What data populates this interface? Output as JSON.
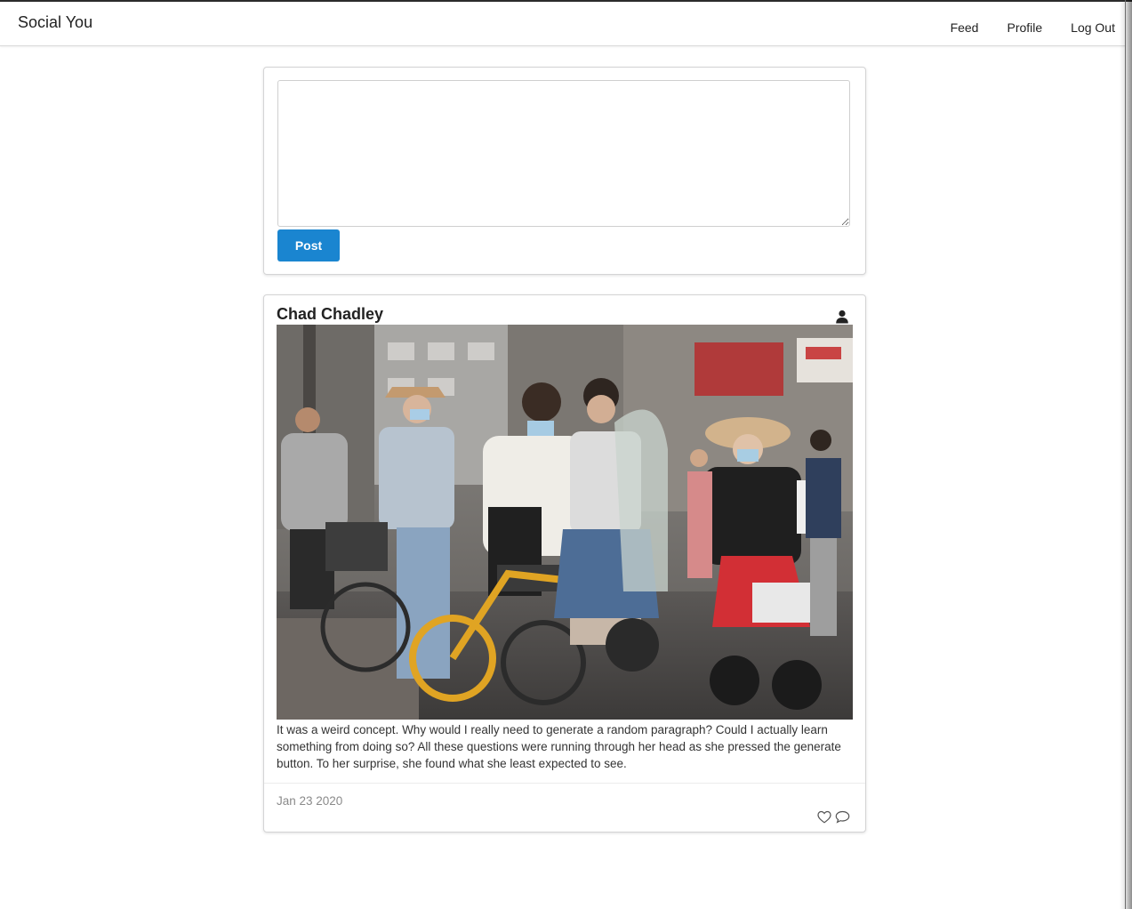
{
  "navbar": {
    "brand": "Social You",
    "links": [
      "Feed",
      "Profile",
      "Log Out"
    ]
  },
  "composer": {
    "textarea_value": "",
    "post_button": "Post"
  },
  "post": {
    "author": "Chad Chadley",
    "author_icon": "user-icon",
    "image_description_icon": "street-photo",
    "text": "It was a weird concept. Why would I really need to generate a random paragraph? Could I actually learn something from doing so? All these questions were running through her head as she pressed the generate button. To her surprise, she found what she least expected to see.",
    "date": "Jan 23 2020",
    "like_icon": "heart-icon",
    "comment_icon": "comment-icon"
  },
  "colors": {
    "primary_button": "#1a85d0",
    "text": "#222222",
    "muted": "#8a8a8a"
  }
}
